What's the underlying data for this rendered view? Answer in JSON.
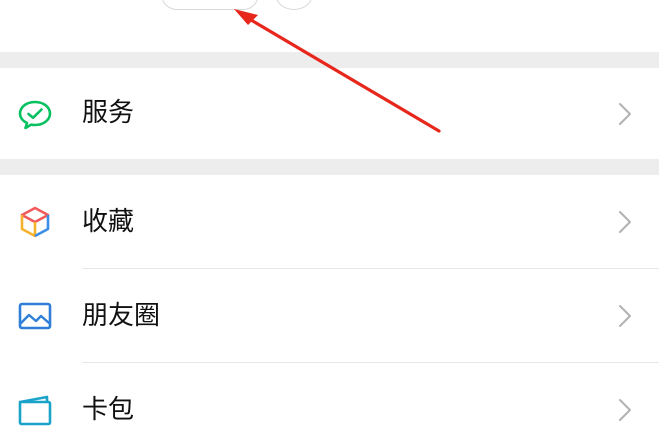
{
  "header": {
    "status_pill_text": "",
    "more_icon": "more-circle-icon"
  },
  "menu": {
    "items": [
      {
        "label": "服务",
        "icon": "wechat-pay-icon"
      },
      {
        "label": "收藏",
        "icon": "cube-icon"
      },
      {
        "label": "朋友圈",
        "icon": "photo-icon"
      },
      {
        "label": "卡包",
        "icon": "card-wallet-icon"
      }
    ]
  },
  "colors": {
    "accent_green": "#07c160",
    "annotation_red": "#e8271c",
    "separator": "#ededed",
    "chevron": "#b2b2b2"
  },
  "annotation": {
    "type": "red-arrow",
    "points_to": "status-pill"
  }
}
